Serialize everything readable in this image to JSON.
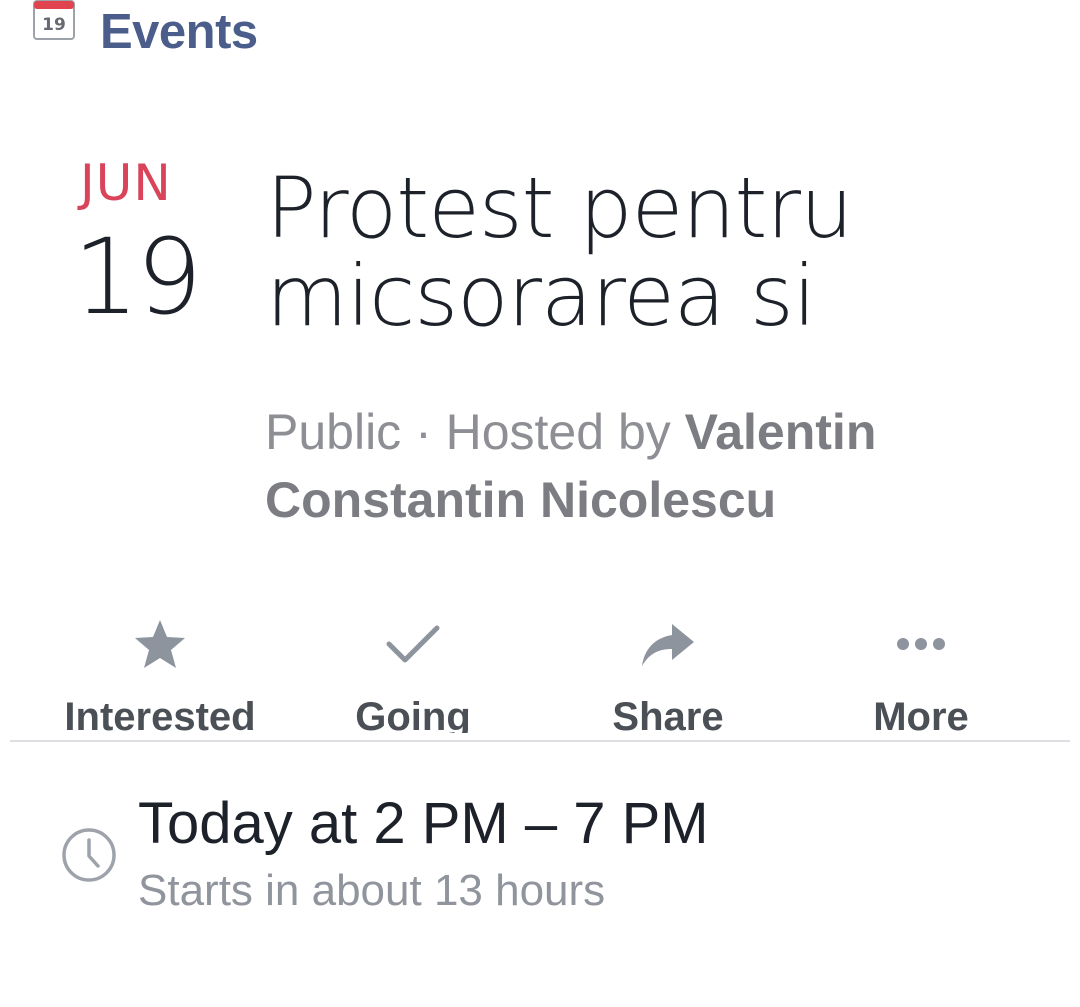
{
  "header": {
    "title": "Events",
    "calendar_icon_day": "19",
    "icon": "calendar-icon"
  },
  "event": {
    "month": "JUN",
    "day": "19",
    "title": "Protest pentru micsorarea si",
    "privacy": "Public",
    "separator": " · ",
    "hosted_by_prefix": "Hosted by ",
    "host_name": "Valentin Constantin Nicolescu"
  },
  "actions": [
    {
      "label": "Interested",
      "icon": "star-icon"
    },
    {
      "label": "Going",
      "icon": "check-icon"
    },
    {
      "label": "Share",
      "icon": "share-arrow-icon"
    },
    {
      "label": "More",
      "icon": "more-dots-icon"
    }
  ],
  "time": {
    "icon": "clock-icon",
    "main": "Today at 2 PM – 7 PM",
    "sub": "Starts in about 13 hours"
  },
  "colors": {
    "accent": "#4b5d8a",
    "month_red": "#d9445b",
    "icon_gray": "#8d949e",
    "text_dark": "#1d2129",
    "text_gray": "#8d8f94"
  }
}
